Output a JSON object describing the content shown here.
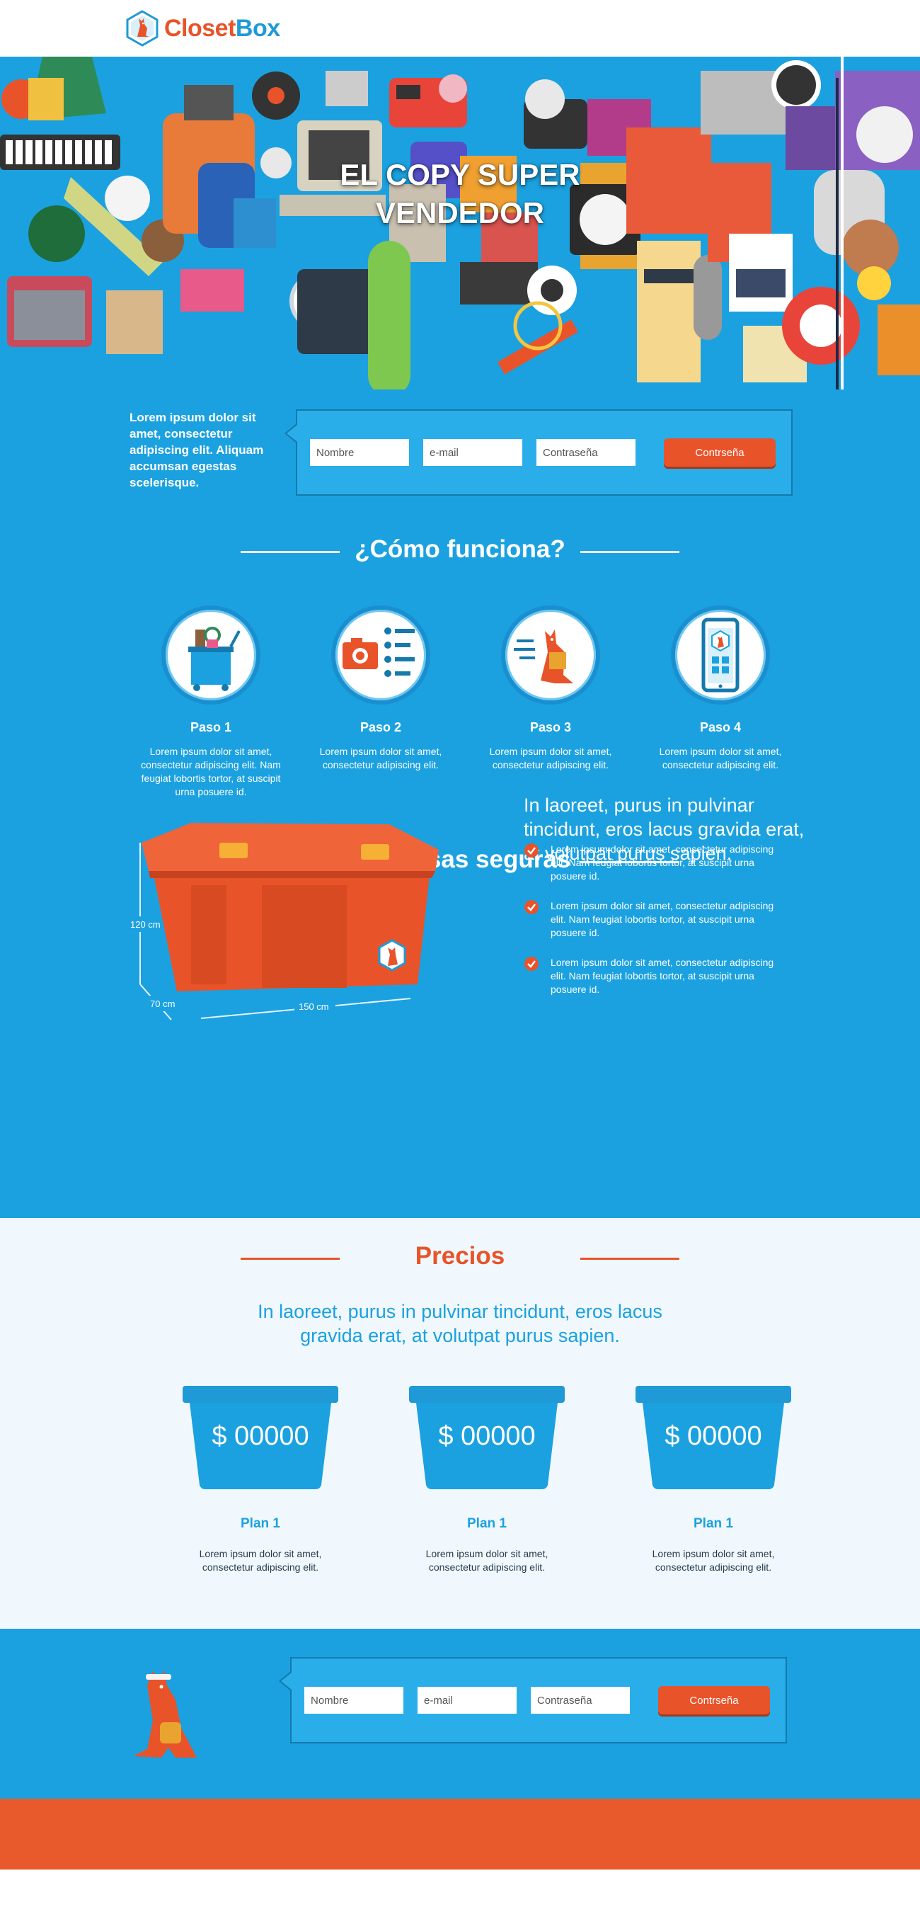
{
  "brand": {
    "name_part1": "Closet",
    "name_part2": "Box",
    "accent_blue": "#1ba1e0",
    "accent_orange": "#e8532a"
  },
  "hero": {
    "title_line1": "EL COPY SUPER",
    "title_line2": "VENDEDOR"
  },
  "signup": {
    "text": "Lorem ipsum dolor sit amet, consectetur adipiscing elit. Aliquam accumsan egestas scelerisque.",
    "name_placeholder": "Nombre",
    "email_placeholder": "e-mail",
    "password_placeholder": "Contraseña",
    "button_label": "Contrseña"
  },
  "how": {
    "title": "¿Cómo funciona?",
    "steps": [
      {
        "title": "Paso 1",
        "desc": "Lorem ipsum dolor sit amet, consectetur adipiscing elit. Nam feugiat lobortis tortor, at suscipit urna posuere id.",
        "icon": "trash-bin-icon"
      },
      {
        "title": "Paso 2",
        "desc": "Lorem ipsum dolor sit amet, consectetur adipiscing elit.",
        "icon": "camera-list-icon"
      },
      {
        "title": "Paso 3",
        "desc": "Lorem ipsum dolor sit amet, consectetur adipiscing elit.",
        "icon": "kangaroo-icon"
      },
      {
        "title": "Paso 4",
        "desc": "Lorem ipsum dolor sit amet, consectetur adipiscing elit.",
        "icon": "phone-app-icon"
      }
    ]
  },
  "safe": {
    "title": "Tus cosas seguras",
    "lead": "In laoreet, purus in pulvinar tincidunt, eros lacus gravida erat, at volutpat purus sapien.",
    "dim_height": "120 cm",
    "dim_depth": "70 cm",
    "dim_width": "150 cm",
    "items": [
      "Lorem ipsum dolor sit amet, consectetur adipiscing elit. Nam feugiat lobortis tortor, at suscipit urna posuere id.",
      "Lorem ipsum dolor sit amet, consectetur adipiscing elit. Nam feugiat lobortis tortor, at suscipit urna posuere id.",
      "Lorem ipsum dolor sit amet, consectetur adipiscing elit. Nam feugiat lobortis tortor, at suscipit urna posuere id."
    ]
  },
  "prices": {
    "title": "Precios",
    "lead_line1": "In laoreet, purus in pulvinar tincidunt, eros lacus",
    "lead_line2": "gravida erat, at volutpat purus sapien.",
    "plans": [
      {
        "price": "$ 00000",
        "name": "Plan 1",
        "desc": "Lorem ipsum dolor sit amet, consectetur adipiscing elit."
      },
      {
        "price": "$ 00000",
        "name": "Plan 1",
        "desc": "Lorem ipsum dolor sit amet, consectetur adipiscing elit."
      },
      {
        "price": "$ 00000",
        "name": "Plan 1",
        "desc": "Lorem ipsum dolor sit amet, consectetur adipiscing elit."
      }
    ]
  }
}
